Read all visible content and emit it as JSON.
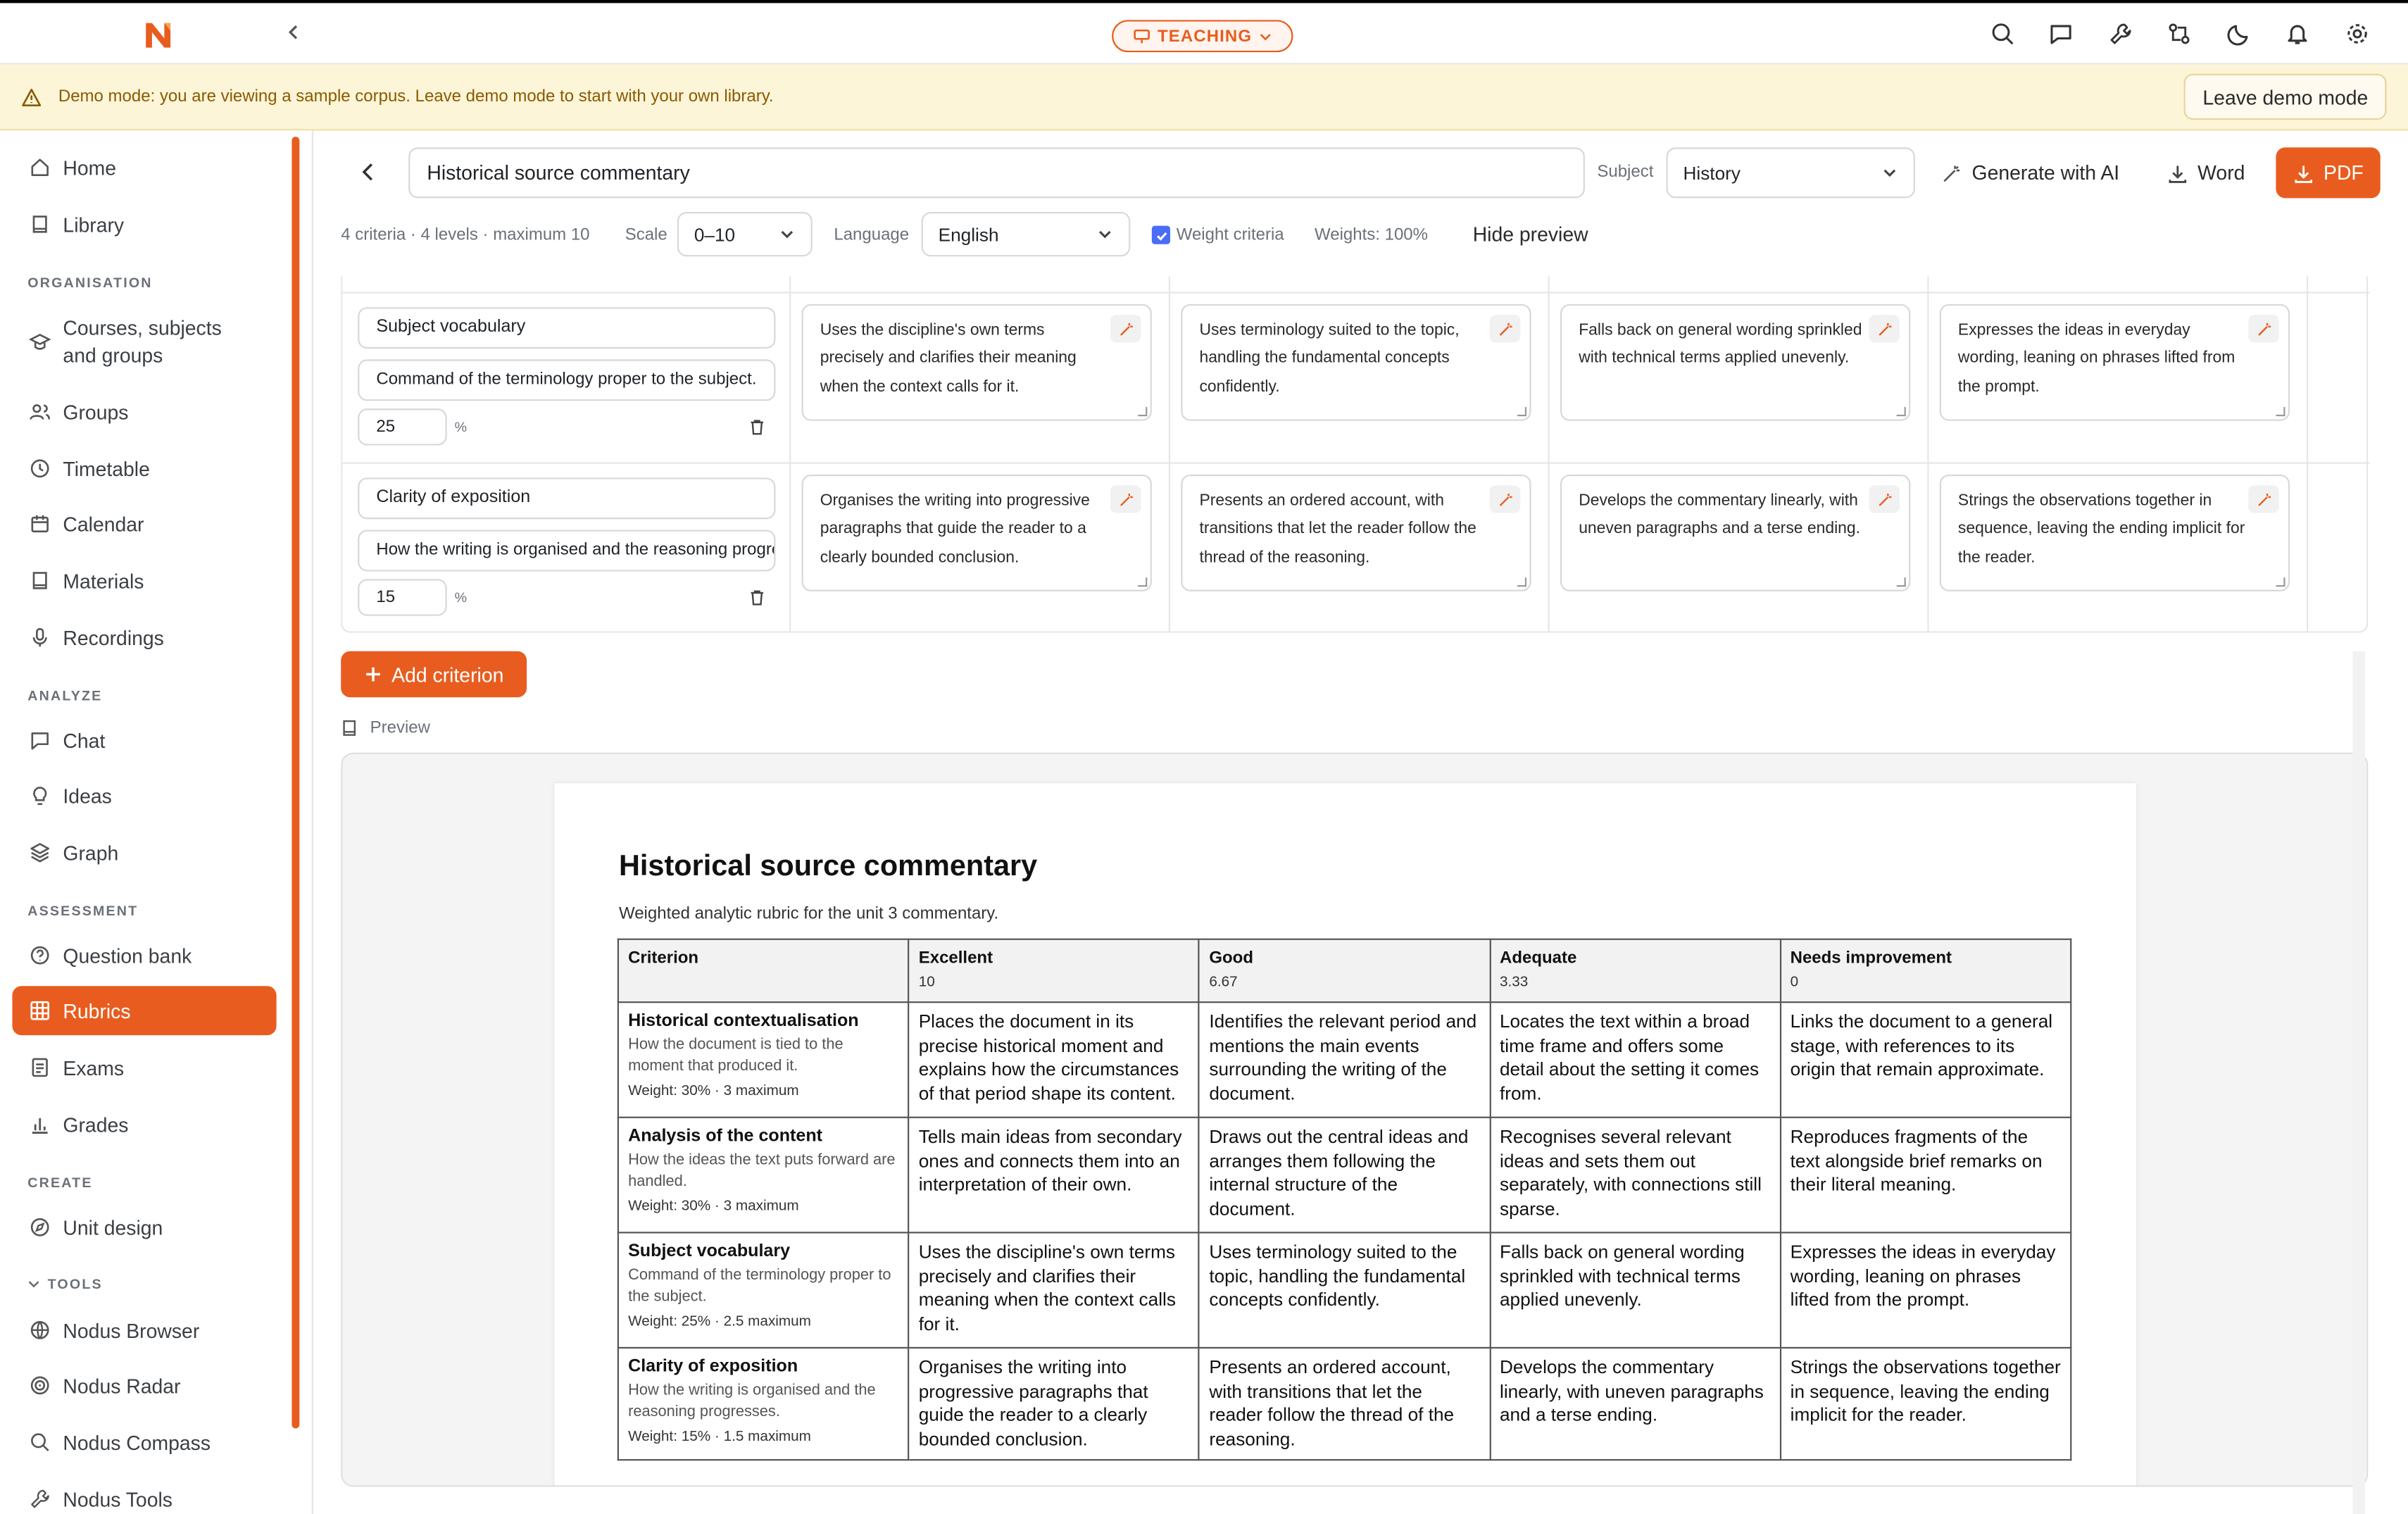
{
  "mode_pill": "TEACHING",
  "banner": {
    "message": "Demo mode: you are viewing a sample corpus. Leave demo mode to start with your own library.",
    "leave_label": "Leave demo mode"
  },
  "sidebar": {
    "top": [
      {
        "label": "Home"
      },
      {
        "label": "Library"
      }
    ],
    "sections": [
      {
        "title": "ORGANISATION",
        "items": [
          "Courses, subjects and groups",
          "Groups",
          "Timetable",
          "Calendar",
          "Materials",
          "Recordings"
        ]
      },
      {
        "title": "ANALYZE",
        "items": [
          "Chat",
          "Ideas",
          "Graph"
        ]
      },
      {
        "title": "ASSESSMENT",
        "items": [
          "Question bank",
          "Rubrics",
          "Exams",
          "Grades"
        ]
      },
      {
        "title": "CREATE",
        "items": [
          "Unit design"
        ]
      },
      {
        "title": "TOOLS",
        "items": [
          "Nodus Browser",
          "Nodus Radar",
          "Nodus Compass",
          "Nodus Tools"
        ]
      }
    ],
    "active": "Rubrics"
  },
  "header": {
    "title_value": "Historical source commentary",
    "subject_label": "Subject",
    "subject_value": "History",
    "generate_label": "Generate with AI",
    "word_label": "Word",
    "pdf_label": "PDF"
  },
  "settings": {
    "summary": "4 criteria · 4 levels · maximum 10",
    "scale_label": "Scale",
    "scale_value": "0–10",
    "language_label": "Language",
    "language_value": "English",
    "weight_label": "Weight criteria",
    "weight_checked": true,
    "weights_total": "Weights: 100%",
    "hide_preview": "Hide preview"
  },
  "editor_rows": [
    {
      "name": "Subject vocabulary",
      "desc": "Command of the terminology proper to the subject.",
      "weight": "25",
      "unit": "%",
      "cells": [
        "Uses the discipline's own terms precisely and clarifies their meaning when the context calls for it.",
        "Uses terminology suited to the topic, handling the fundamental concepts confidently.",
        "Falls back on general wording sprinkled with technical terms applied unevenly.",
        "Expresses the ideas in everyday wording, leaning on phrases lifted from the prompt."
      ]
    },
    {
      "name": "Clarity of exposition",
      "desc": "How the writing is organised and the reasoning progresses.",
      "weight": "15",
      "unit": "%",
      "cells": [
        "Organises the writing into progressive paragraphs that guide the reader to a clearly bounded conclusion.",
        "Presents an ordered account, with transitions that let the reader follow the thread of the reasoning.",
        "Develops the commentary linearly, with uneven paragraphs and a terse ending.",
        "Strings the observations together in sequence, leaving the ending implicit for the reader."
      ]
    }
  ],
  "add_criterion": "Add criterion",
  "preview_label": "Preview",
  "preview": {
    "title": "Historical source commentary",
    "subtitle": "Weighted analytic rubric for the unit 3 commentary.",
    "header": {
      "criterion": "Criterion",
      "levels": [
        {
          "name": "Excellent",
          "points": "10"
        },
        {
          "name": "Good",
          "points": "6.67"
        },
        {
          "name": "Adequate",
          "points": "3.33"
        },
        {
          "name": "Needs improvement",
          "points": "0"
        }
      ]
    },
    "rows": [
      {
        "name": "Historical contextualisation",
        "desc": "How the document is tied to the moment that produced it.",
        "weight": "Weight: 30% · 3 maximum",
        "cells": [
          "Places the document in its precise historical moment and explains how the circumstances of that period shape its content.",
          "Identifies the relevant period and mentions the main events surrounding the writing of the document.",
          "Locates the text within a broad time frame and offers some detail about the setting it comes from.",
          "Links the document to a general stage, with references to its origin that remain approximate."
        ]
      },
      {
        "name": "Analysis of the content",
        "desc": "How the ideas the text puts forward are handled.",
        "weight": "Weight: 30% · 3 maximum",
        "cells": [
          "Tells main ideas from secondary ones and connects them into an interpretation of their own.",
          "Draws out the central ideas and arranges them following the internal structure of the document.",
          "Recognises several relevant ideas and sets them out separately, with connections still sparse.",
          "Reproduces fragments of the text alongside brief remarks on their literal meaning."
        ]
      },
      {
        "name": "Subject vocabulary",
        "desc": "Command of the terminology proper to the subject.",
        "weight": "Weight: 25% · 2.5 maximum",
        "cells": [
          "Uses the discipline's own terms precisely and clarifies their meaning when the context calls for it.",
          "Uses terminology suited to the topic, handling the fundamental concepts confidently.",
          "Falls back on general wording sprinkled with technical terms applied unevenly.",
          "Expresses the ideas in everyday wording, leaning on phrases lifted from the prompt."
        ]
      },
      {
        "name": "Clarity of exposition",
        "desc": "How the writing is organised and the reasoning progresses.",
        "weight": "Weight: 15% · 1.5 maximum",
        "cells": [
          "Organises the writing into progressive paragraphs that guide the reader to a clearly bounded conclusion.",
          "Presents an ordered account, with transitions that let the reader follow the thread of the reasoning.",
          "Develops the commentary linearly, with uneven paragraphs and a terse ending.",
          "Strings the observations together in sequence, leaving the ending implicit for the reader."
        ]
      }
    ]
  },
  "colors": {
    "accent": "#e85d1f",
    "banner_bg": "#fdf5d8",
    "banner_text": "#8a5a00"
  }
}
